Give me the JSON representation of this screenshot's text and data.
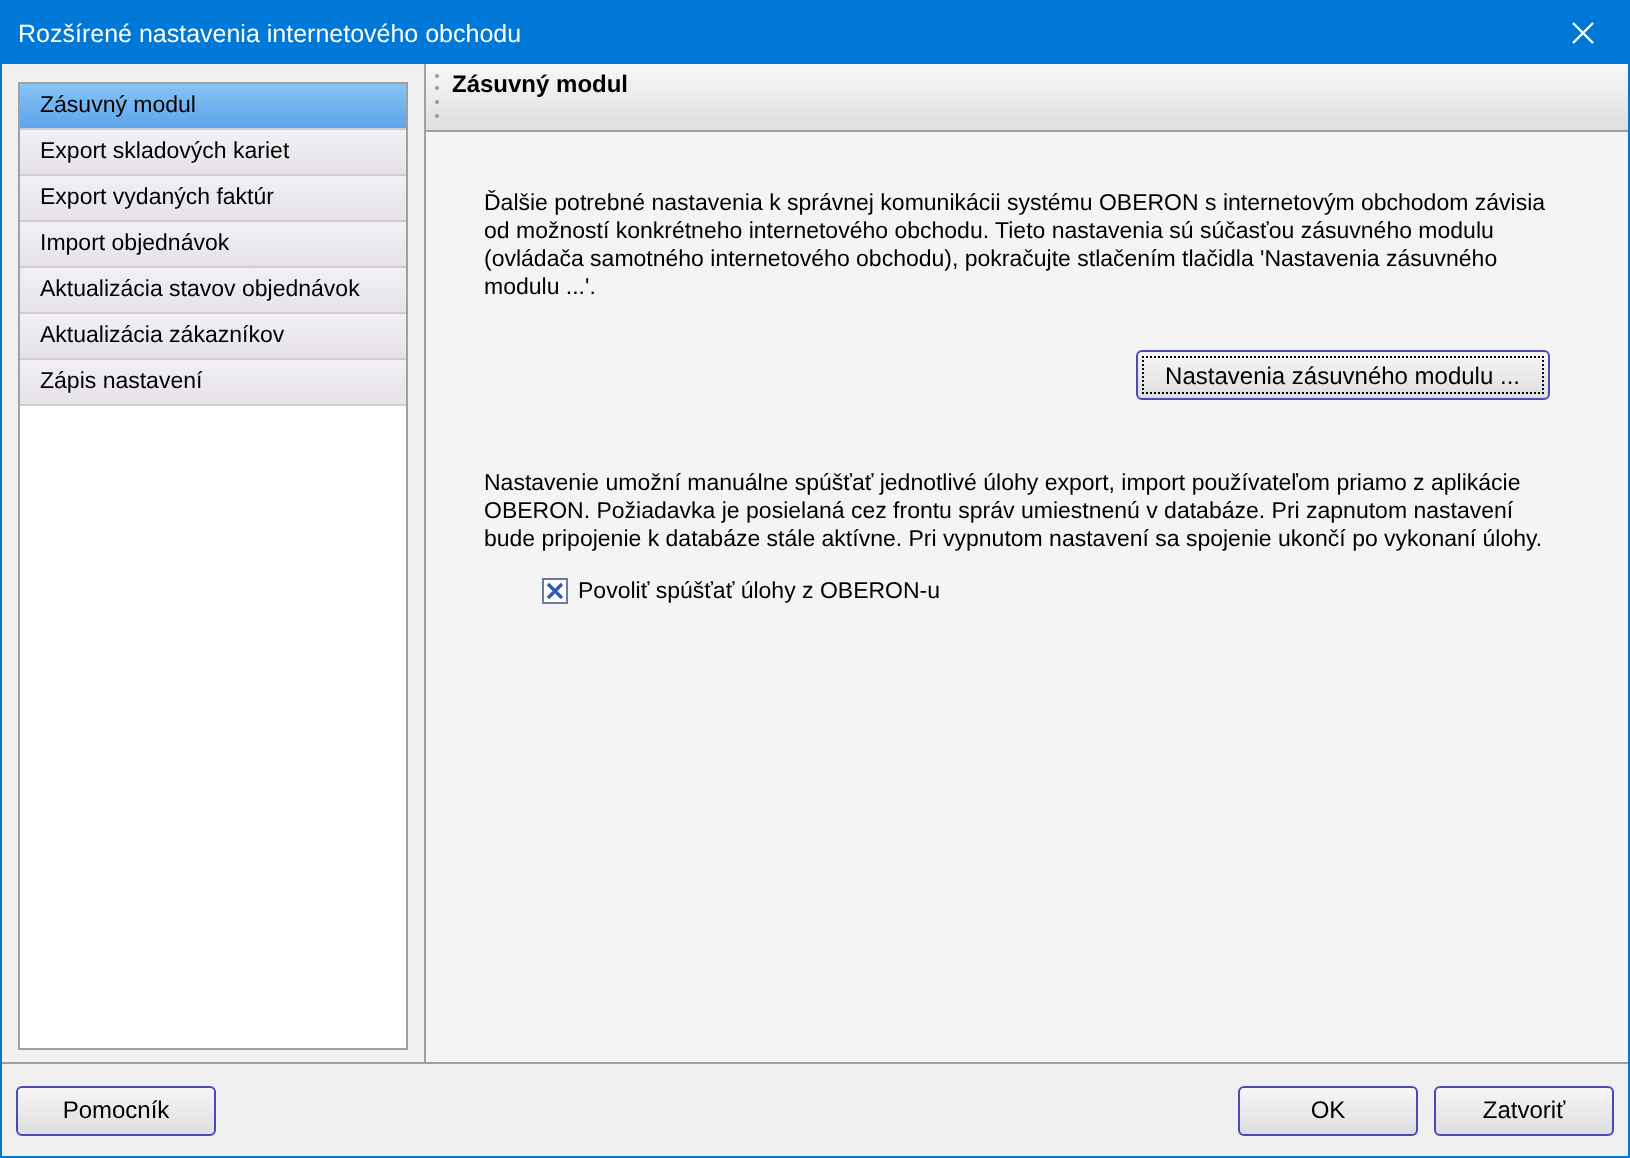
{
  "window": {
    "title": "Rozšírené nastavenia internetového obchodu"
  },
  "sidebar": {
    "items": [
      {
        "label": "Zásuvný modul",
        "selected": true
      },
      {
        "label": "Export skladových kariet",
        "selected": false
      },
      {
        "label": "Export vydaných faktúr",
        "selected": false
      },
      {
        "label": "Import objednávok",
        "selected": false
      },
      {
        "label": "Aktualizácia stavov objednávok",
        "selected": false
      },
      {
        "label": "Aktualizácia zákazníkov",
        "selected": false
      },
      {
        "label": "Zápis nastavení",
        "selected": false
      }
    ]
  },
  "panel": {
    "title": "Zásuvný modul",
    "description": "Ďalšie potrebné nastavenia k správnej komunikácii systému OBERON s internetovým obchodom závisia od možností konkrétneho internetového obchodu. Tieto nastavenia sú súčasťou zásuvného modulu (ovládača samotného internetového obchodu), pokračujte stlačením tlačidla 'Nastavenia zásuvného modulu ...'.",
    "plugin_button": "Nastavenia zásuvného modulu ...",
    "note": "Nastavenie umožní manuálne spúšťať jednotlivé úlohy export, import používateľom priamo z aplikácie OBERON. Požiadavka je posielaná cez frontu správ umiestnenú v databáze. Pri zapnutom nastavení bude pripojenie k databáze stále aktívne. Pri vypnutom nastavení sa spojenie ukončí po vykonaní úlohy.",
    "checkbox": {
      "label": "Povoliť spúšťať úlohy z OBERON-u",
      "checked": true
    }
  },
  "footer": {
    "help_button": "Pomocník",
    "ok_button": "OK",
    "close_button": "Zatvoriť"
  }
}
